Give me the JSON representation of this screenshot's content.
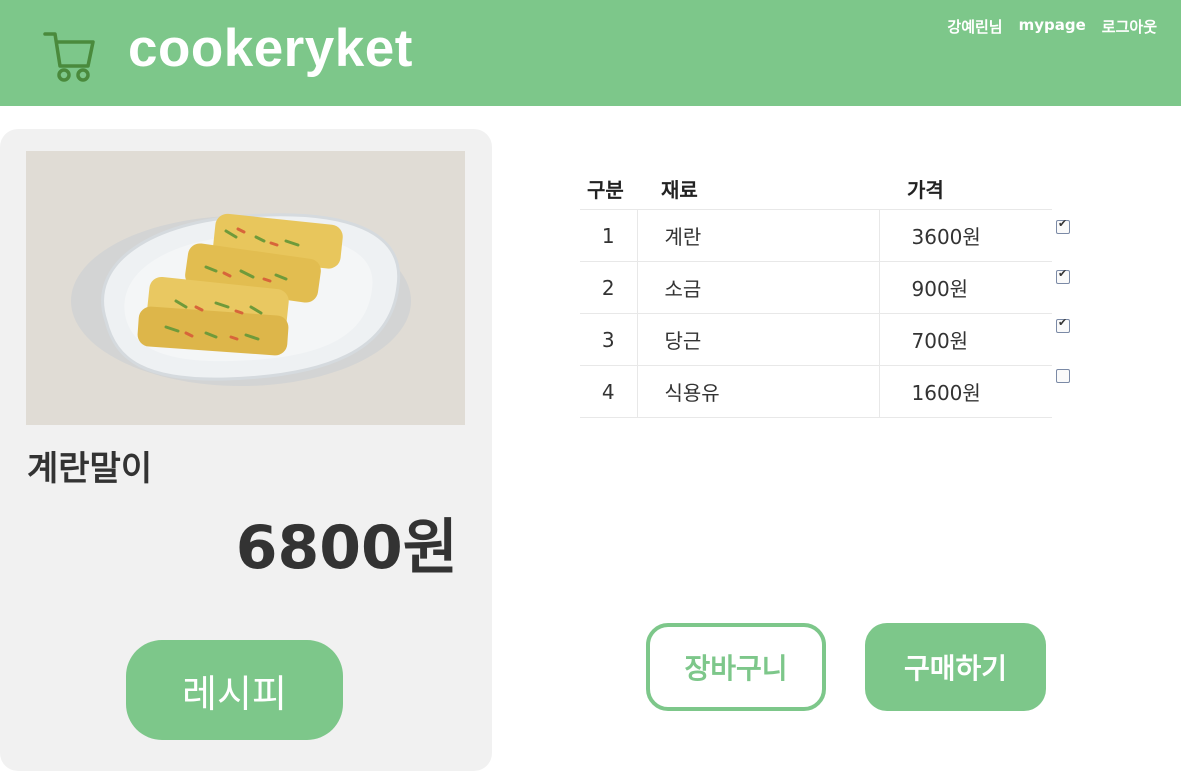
{
  "header": {
    "brand": "cookeryket",
    "logo_icon": "shopping-cart-icon",
    "user_name": "강예린님",
    "mypage_label": "mypage",
    "logout_label": "로그아웃",
    "bg_color": "#7dc78a"
  },
  "product": {
    "image_icon": "rolled-omelette-photo",
    "name": "계란말이",
    "price": "6800원",
    "recipe_label": "레시피"
  },
  "ingredients": {
    "headers": [
      "구분",
      "재료",
      "가격"
    ],
    "rows": [
      {
        "num": "1",
        "name": "계란",
        "price": "3600원",
        "checked": true
      },
      {
        "num": "2",
        "name": "소금",
        "price": "900원",
        "checked": true
      },
      {
        "num": "3",
        "name": "당근",
        "price": "700원",
        "checked": true
      },
      {
        "num": "4",
        "name": "식용유",
        "price": "1600원",
        "checked": false
      }
    ]
  },
  "actions": {
    "cart_label": "장바구니",
    "buy_label": "구매하기"
  }
}
